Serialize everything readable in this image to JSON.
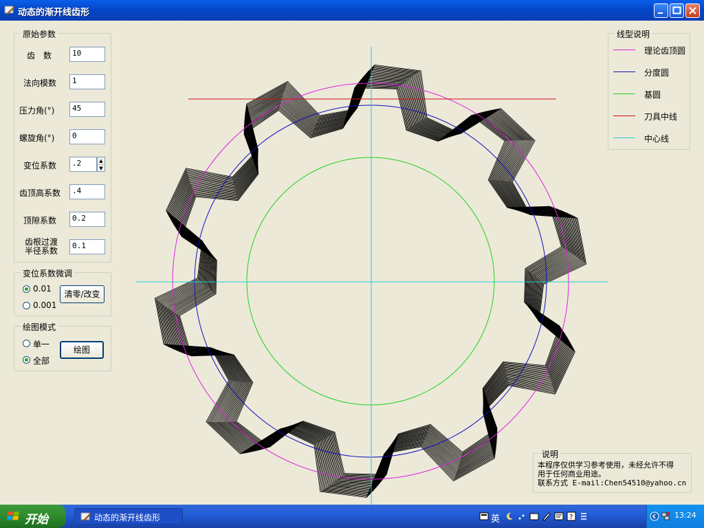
{
  "window": {
    "title": "动态的渐开线齿形"
  },
  "params": {
    "legend": "原始参数",
    "fields": [
      {
        "label": "齿　数",
        "value": "10"
      },
      {
        "label": "法向模数",
        "value": "1"
      },
      {
        "label": "压力角(°)",
        "value": "45"
      },
      {
        "label": "螺旋角(°)",
        "value": "0"
      },
      {
        "label": "变位系数",
        "value": ".2"
      },
      {
        "label": "齿顶高系数",
        "value": ".4"
      },
      {
        "label": "顶隙系数",
        "value": "0.2"
      },
      {
        "label": "齿根过渡",
        "label2": "半径系数",
        "value": "0.1"
      }
    ]
  },
  "fine_tune": {
    "legend": "变位系数微调",
    "options": [
      "0.01",
      "0.001"
    ],
    "selected": 0,
    "button": "清零/改变"
  },
  "draw_mode": {
    "legend": "绘图模式",
    "options": [
      "单一",
      "全部"
    ],
    "selected": 1,
    "button": "绘图"
  },
  "legend_panel": {
    "legend": "线型说明",
    "items": [
      {
        "label": "理论齿顶圆",
        "color": "#e020e0"
      },
      {
        "label": "分度圆",
        "color": "#1010c0"
      },
      {
        "label": "基圆",
        "color": "#20d020"
      },
      {
        "label": "刀具中线",
        "color": "#d01010"
      },
      {
        "label": "中心线",
        "color": "#20d0d0"
      }
    ]
  },
  "note": {
    "legend": "说明",
    "line1": "本程序仅供学习参考使用，未经允许不得",
    "line2": "用于任何商业用途。",
    "line3": "联系方式 E-mail:Chen54510@yahoo.cn"
  },
  "drawing": {
    "teeth": 10,
    "addendum_color": "#e020e0",
    "pitch_color": "#1010c0",
    "base_color": "#20d020",
    "rack_color": "#d01010",
    "center_color": "#20d0d0",
    "profile_color": "#000000"
  },
  "taskbar": {
    "start_label": "开始",
    "task_label": "动态的渐开线齿形",
    "ime_label": "英",
    "clock": "13:24"
  }
}
